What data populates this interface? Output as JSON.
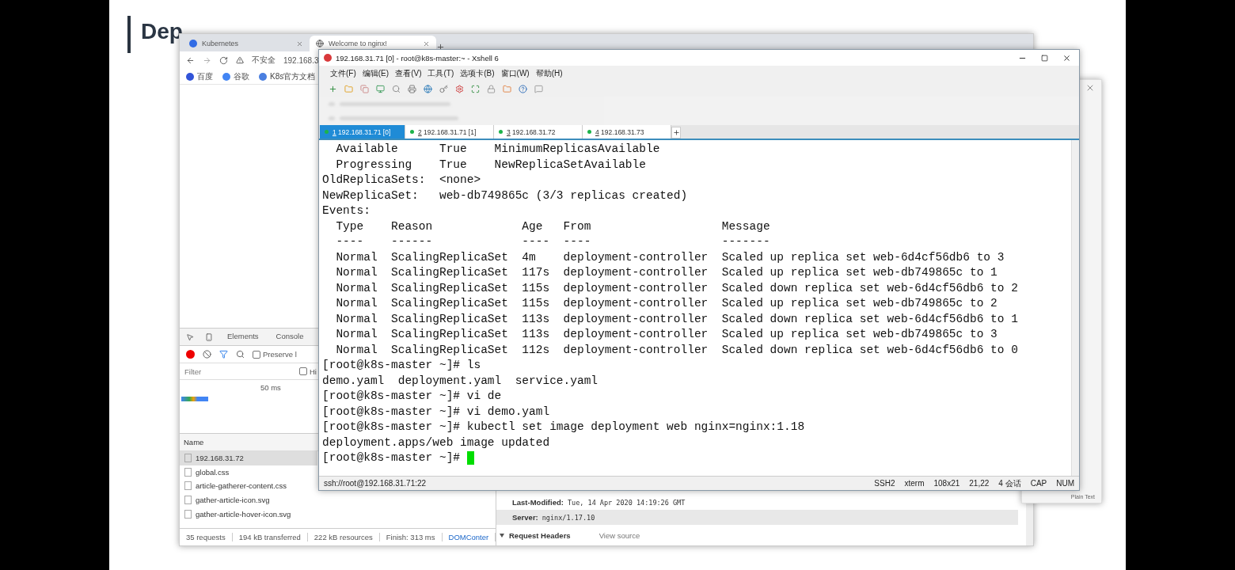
{
  "slide": {
    "title": "Dep"
  },
  "browser": {
    "tabs": [
      {
        "label": "Kubernetes",
        "selected": false
      },
      {
        "label": "Welcome to nginx!",
        "selected": true
      }
    ],
    "security": "不安全",
    "address": "192.168.3",
    "bookmarks": [
      "百度",
      "谷歌",
      "K8s官方文档"
    ],
    "devtools": {
      "tabs": [
        {
          "label": "Elements",
          "selected": false
        },
        {
          "label": "Console",
          "selected": false
        }
      ],
      "preserve_log": {
        "label": "Preserve l",
        "checked": false
      },
      "filter": {
        "placeholder": "Filter"
      },
      "hide_data": {
        "label": "Hi",
        "checked": false
      },
      "timeline_tick": "50 ms",
      "name_header": "Name",
      "requests": [
        {
          "name": "192.168.31.72",
          "selected": true
        },
        {
          "name": "global.css",
          "selected": false
        },
        {
          "name": "article-gatherer-content.css",
          "selected": false
        },
        {
          "name": "gather-article-icon.svg",
          "selected": false
        },
        {
          "name": "gather-article-hover-icon.svg",
          "selected": false
        }
      ],
      "summary": [
        "35 requests",
        "194 kB transferred",
        "222 kB resources",
        "Finish: 313 ms",
        "DOMConter"
      ],
      "headers": [
        {
          "key": "Last-Modified:",
          "value": "Tue, 14 Apr 2020 14:19:26 GMT",
          "selected": false
        },
        {
          "key": "Server:",
          "value": "nginx/1.17.10",
          "selected": true
        }
      ],
      "section": {
        "title": "Request Headers",
        "expanded": true,
        "link": "View source"
      }
    }
  },
  "xshell": {
    "title": "192.168.31.71 [0] - root@k8s-master:~ - Xshell 6",
    "menu": [
      "文件(F)",
      "编辑(E)",
      "查看(V)",
      "工具(T)",
      "选项卡(B)",
      "窗口(W)",
      "帮助(H)"
    ],
    "tabs": [
      {
        "number": "1",
        "label": "192.168.31.71 [0]",
        "selected": true
      },
      {
        "number": "2",
        "label": "192.168.31.71 [1]",
        "selected": false
      },
      {
        "number": "3",
        "label": "192.168.31.72",
        "selected": false
      },
      {
        "number": "4",
        "label": "192.168.31.73",
        "selected": false
      }
    ],
    "terminal": {
      "lines": [
        "  Available      True    MinimumReplicasAvailable",
        "  Progressing    True    NewReplicaSetAvailable",
        "OldReplicaSets:  <none>",
        "NewReplicaSet:   web-db749865c (3/3 replicas created)",
        "Events:",
        "  Type    Reason             Age   From                   Message",
        "  ----    ------             ----  ----                   -------",
        "  Normal  ScalingReplicaSet  4m    deployment-controller  Scaled up replica set web-6d4cf56db6 to 3",
        "  Normal  ScalingReplicaSet  117s  deployment-controller  Scaled up replica set web-db749865c to 1",
        "  Normal  ScalingReplicaSet  115s  deployment-controller  Scaled down replica set web-6d4cf56db6 to 2",
        "  Normal  ScalingReplicaSet  115s  deployment-controller  Scaled up replica set web-db749865c to 2",
        "  Normal  ScalingReplicaSet  113s  deployment-controller  Scaled down replica set web-6d4cf56db6 to 1",
        "  Normal  ScalingReplicaSet  113s  deployment-controller  Scaled up replica set web-db749865c to 3",
        "  Normal  ScalingReplicaSet  112s  deployment-controller  Scaled down replica set web-6d4cf56db6 to 0",
        "[root@k8s-master ~]# ls",
        "demo.yaml  deployment.yaml  service.yaml",
        "[root@k8s-master ~]# vi de",
        "[root@k8s-master ~]# vi demo.yaml",
        "[root@k8s-master ~]# kubectl set image deployment web nginx=nginx:1.18",
        "deployment.apps/web image updated",
        "[root@k8s-master ~]# "
      ]
    },
    "status": {
      "address": "ssh://root@192.168.31.71:22",
      "items": [
        "SSH2",
        "xterm",
        "108x21",
        "21,22",
        "4 会话",
        "CAP",
        "NUM"
      ]
    }
  },
  "side_window": {
    "label": "Plain Text"
  }
}
